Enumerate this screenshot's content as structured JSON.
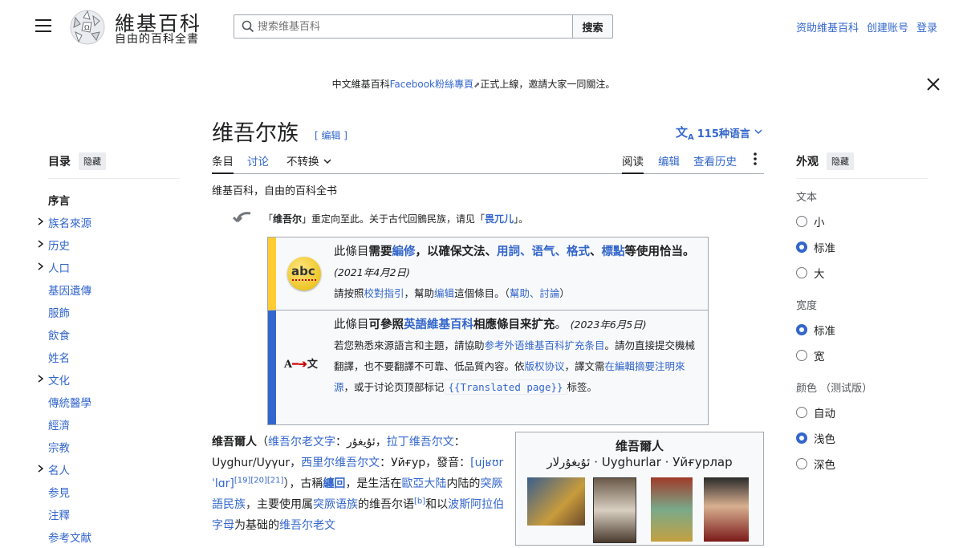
{
  "header": {
    "site_title": "維基百科",
    "site_subtitle": "自由的百科全書",
    "search_placeholder": "搜索维基百科",
    "search_button": "搜索",
    "user_links": [
      "资助维基百科",
      "创建账号",
      "登录"
    ]
  },
  "banner": {
    "prefix": "中文維基百科",
    "link": "Facebook粉絲專頁",
    "suffix": "正式上線，邀請大家一同關注。"
  },
  "toc": {
    "title": "目录",
    "hide": "隐藏",
    "items": [
      {
        "label": "序言",
        "expandable": false,
        "current": true
      },
      {
        "label": "族名來源",
        "expandable": true
      },
      {
        "label": "历史",
        "expandable": true
      },
      {
        "label": "人口",
        "expandable": true
      },
      {
        "label": "基因遺傳",
        "expandable": false
      },
      {
        "label": "服飾",
        "expandable": false
      },
      {
        "label": "飲食",
        "expandable": false
      },
      {
        "label": "姓名",
        "expandable": false
      },
      {
        "label": "文化",
        "expandable": true
      },
      {
        "label": "傳統醫學",
        "expandable": false
      },
      {
        "label": "經濟",
        "expandable": false
      },
      {
        "label": "宗教",
        "expandable": false
      },
      {
        "label": "名人",
        "expandable": true
      },
      {
        "label": "参見",
        "expandable": false
      },
      {
        "label": "注釋",
        "expandable": false
      },
      {
        "label": "参考文献",
        "expandable": false
      }
    ]
  },
  "article": {
    "title": "维吾尔族",
    "edit": "[ 编辑 ]",
    "languages": "115种语言",
    "tabs_left": [
      "条目",
      "讨论",
      "不转换"
    ],
    "tabs_right": [
      "阅读",
      "编辑",
      "查看历史"
    ],
    "tagline": "维基百科，自由的百科全书",
    "hatnote": {
      "p1": "「",
      "bold": "维吾尔",
      "p2": "」重定向至此。关于古代回鶻民族，请见「",
      "link": "畏兀儿",
      "p3": "」。"
    }
  },
  "ambox1": {
    "icon": "abc",
    "t1": "此條目",
    "b1": "需要",
    "l1": "編修",
    "b2": "，以確保文法、",
    "l2": "用詞",
    "s1": "、",
    "l3": "语气",
    "s2": "、",
    "l4": "格式",
    "s3": "、",
    "l5": "標點",
    "b3": "等使用恰当。",
    "date": "(2021年4月2日)",
    "line2_a": "請按照",
    "line2_l1": "校對指引",
    "line2_b": "，幫助",
    "line2_l2": "编辑",
    "line2_c": "這個條目。（",
    "line2_l3": "幫助",
    "line2_d": "、",
    "line2_l4": "討論",
    "line2_e": "）"
  },
  "ambox2": {
    "icon_a": "A",
    "icon_b": "文",
    "t1": "此條目",
    "b1": "可參照",
    "l1": "英語維基百科",
    "b2": "相應條目来扩充",
    "p": "。",
    "date": "(2023年6月5日)",
    "body_a": "若您熟悉來源語言和主題，請協助",
    "body_l1": "参考外语维基百科扩充条目",
    "body_b": "。請勿直接提交機械翻譯，也不要翻譯不可靠、低品質內容。依",
    "body_l2": "版权协议",
    "body_c": "，譯文需",
    "body_l3": "在編輯摘要注明來源",
    "body_d": "，或于讨论页顶部标记",
    "body_code": "{{Translated page}}",
    "body_e": "标签。"
  },
  "lead": {
    "bold": "维吾爾人",
    "a1": "（",
    "l1": "维吾尔老文字",
    "a2": "：ئۇيغۇر，",
    "l2": "拉丁维吾尔文",
    "a3": "：Uyghur/Uyγur，",
    "l3": "西里尔维吾尔文",
    "a4": "：Уйғур，發音：",
    "ipa": "[ujʁʊrˈlɑr]",
    "refs": "[19][20][21]",
    "a5": "），古稱",
    "l4": "纏回",
    "a6": "，是生活在",
    "l5": "歐亞大陆",
    "a7": "内陆的",
    "l6": "突厥語民族",
    "a8": "，主要使用属",
    "l7": "突厥语族",
    "a9": "的维吾尔语",
    "note": "[b]",
    "a10": "和以",
    "l8": "波斯阿拉伯字母",
    "a11": "为基础的",
    "l9": "维吾尔老文"
  },
  "infobox": {
    "title": "维吾爾人",
    "names": "ئۇيغۇرلار · Uyghurlar · Уйғурлар"
  },
  "appearance": {
    "title": "外观",
    "hide": "隐藏",
    "text_label": "文本",
    "text_opts": [
      {
        "label": "小",
        "on": false
      },
      {
        "label": "标准",
        "on": true
      },
      {
        "label": "大",
        "on": false
      }
    ],
    "width_label": "宽度",
    "width_opts": [
      {
        "label": "标准",
        "on": true
      },
      {
        "label": "宽",
        "on": false
      }
    ],
    "color_label": "颜色 （测试版）",
    "color_opts": [
      {
        "label": "自动",
        "on": false
      },
      {
        "label": "浅色",
        "on": true
      },
      {
        "label": "深色",
        "on": false
      }
    ]
  },
  "colors": {
    "link": "#3366cc",
    "ambox_yellow": "#ffcc33",
    "ambox_blue": "#3366cc",
    "radio_selected": "#3366cc"
  }
}
